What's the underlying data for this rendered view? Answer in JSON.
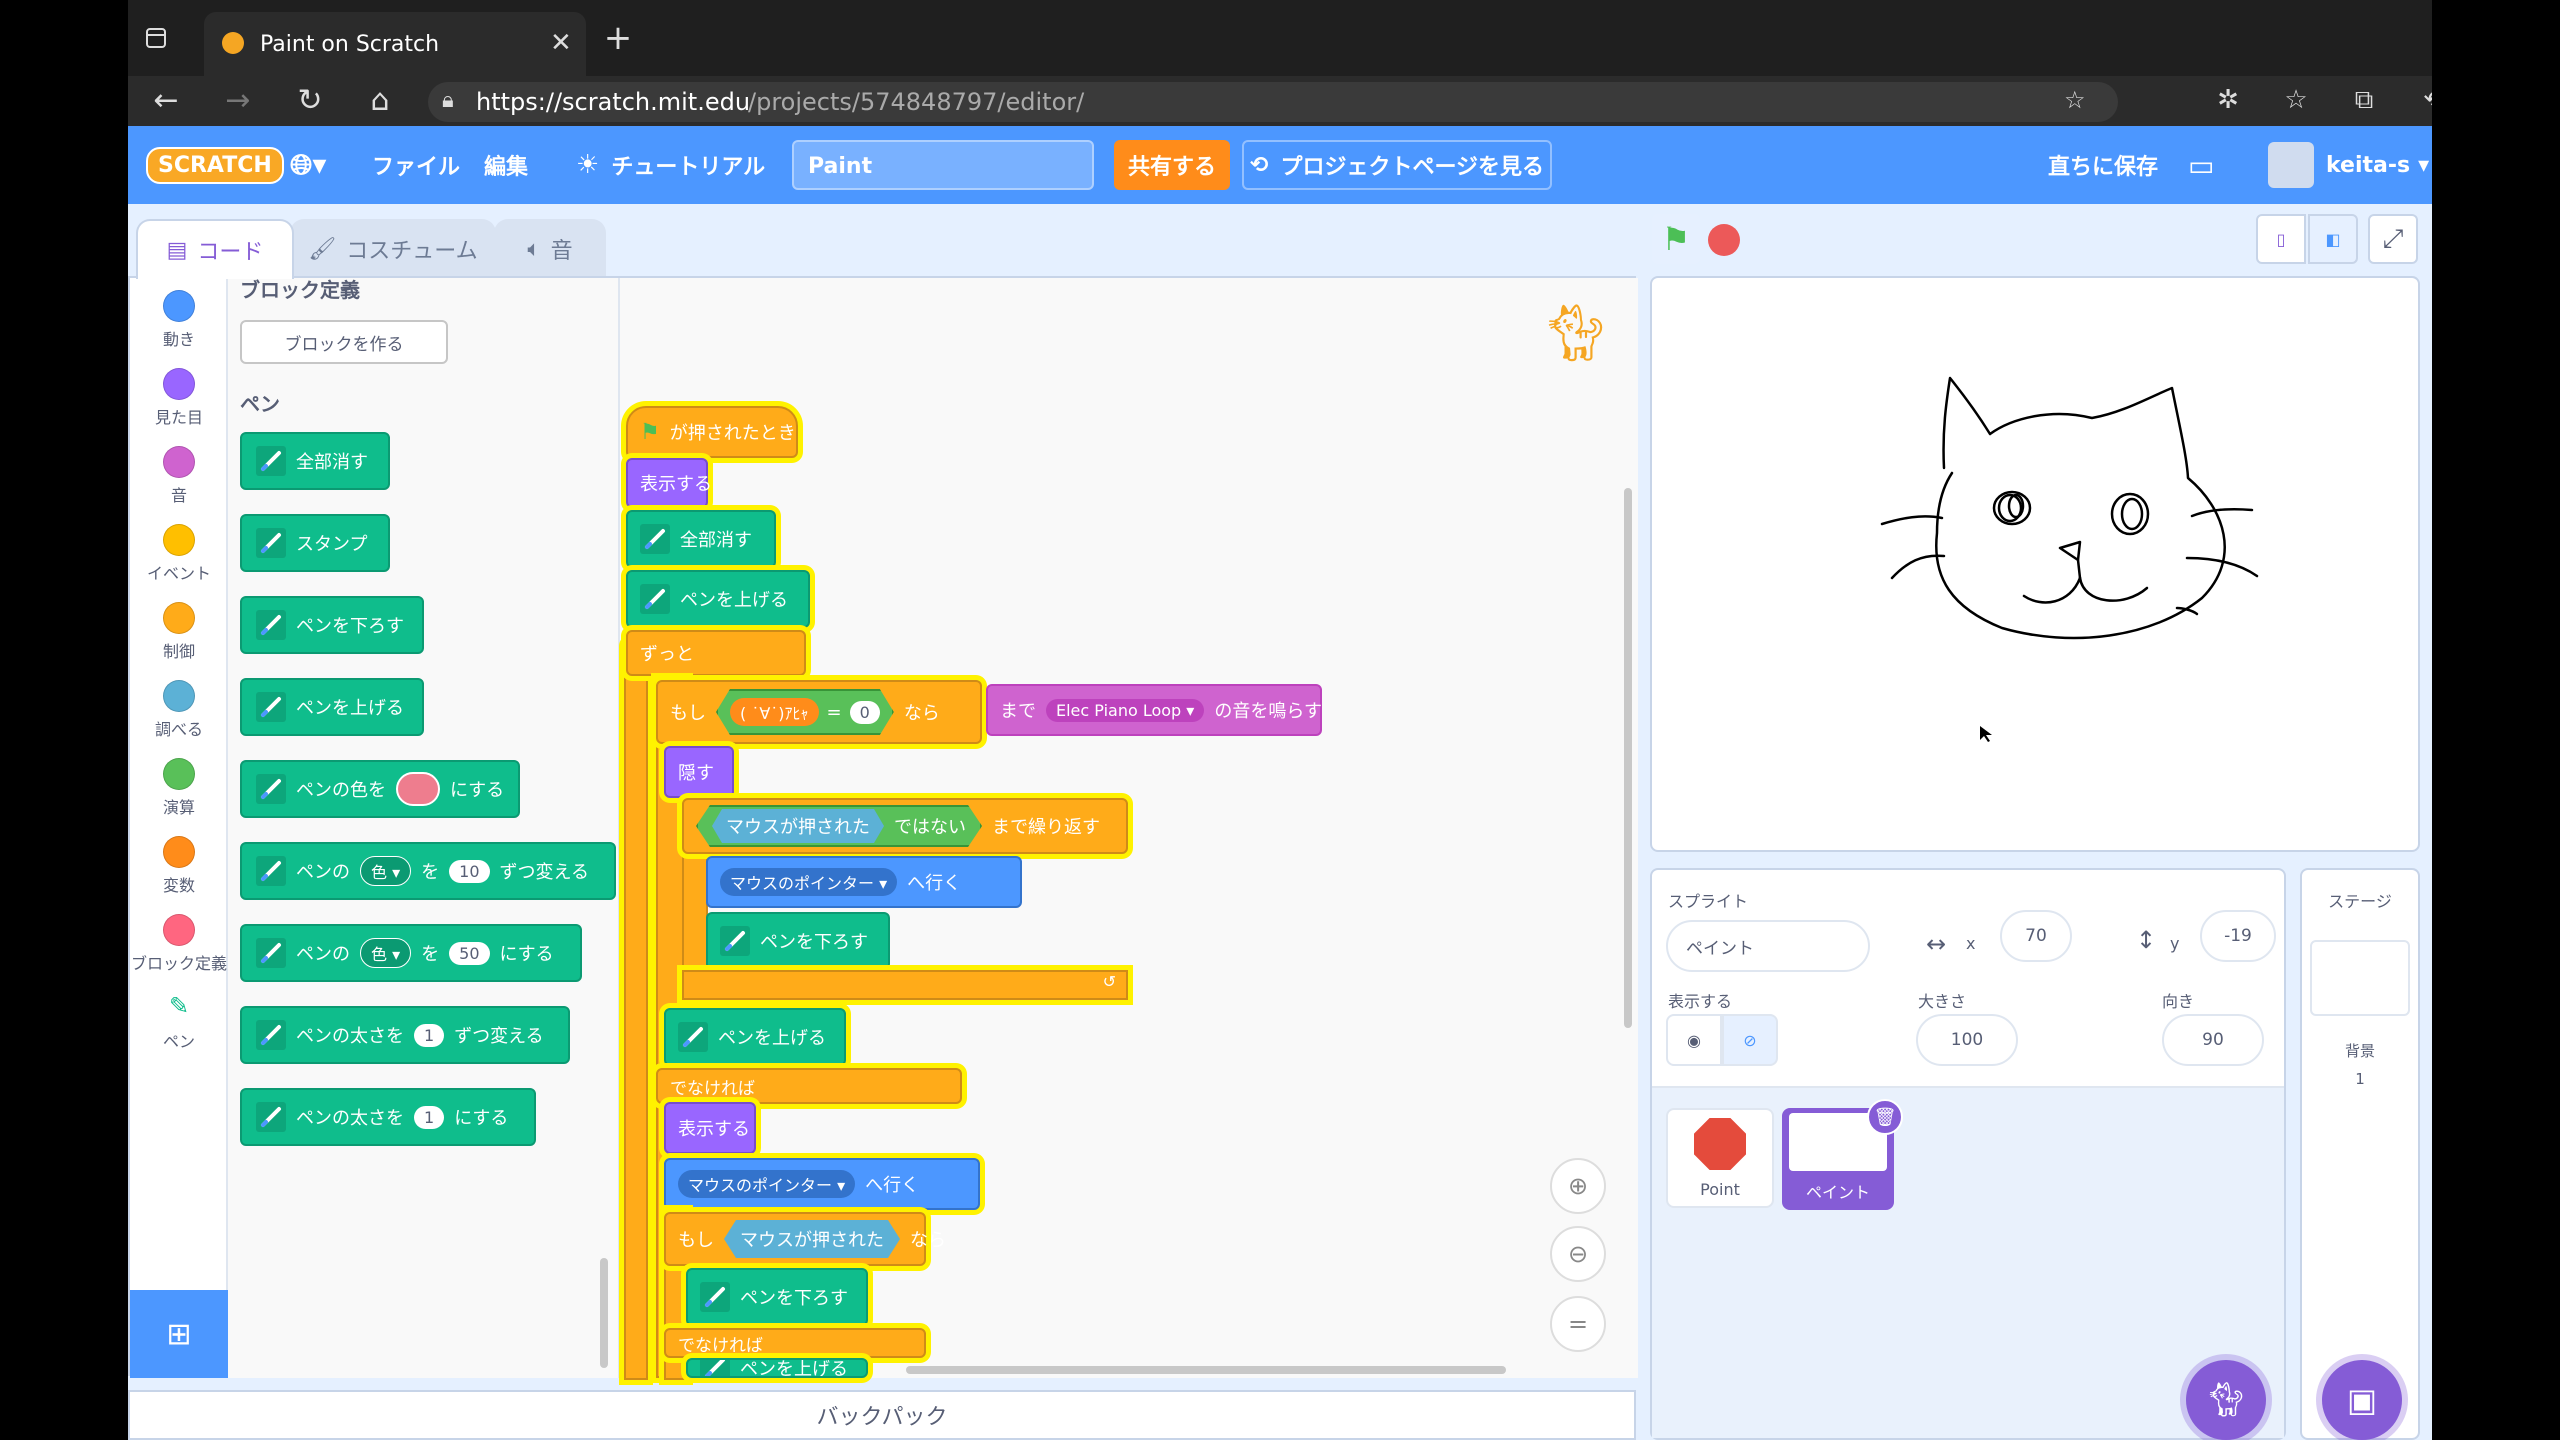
{
  "browser": {
    "tab_title": "Paint on Scratch",
    "url_host": "https://scratch.mit.edu",
    "url_path": "/projects/574848797/editor/"
  },
  "menu": {
    "logo": "SCRATCH",
    "file": "ファイル",
    "edit": "編集",
    "tutorial": "チュートリアル",
    "project_title": "Paint",
    "share": "共有する",
    "see_project_page": "プロジェクトページを見る",
    "save_now": "直ちに保存",
    "username": "keita-s"
  },
  "editor_tabs": {
    "code": "コード",
    "costumes": "コスチューム",
    "sounds": "音"
  },
  "categories": [
    {
      "label": "動き",
      "color": "#4c97ff"
    },
    {
      "label": "見た目",
      "color": "#9966ff"
    },
    {
      "label": "音",
      "color": "#cf63cf"
    },
    {
      "label": "イベント",
      "color": "#ffbf00"
    },
    {
      "label": "制御",
      "color": "#ffab19"
    },
    {
      "label": "調べる",
      "color": "#5cb1d6"
    },
    {
      "label": "演算",
      "color": "#59c059"
    },
    {
      "label": "変数",
      "color": "#ff8c1a"
    },
    {
      "label": "ブロック定義",
      "color": "#ff6680"
    },
    {
      "label": "ペン",
      "color": ""
    }
  ],
  "palette": {
    "section_my_blocks": "ブロック定義",
    "make_block": "ブロックを作る",
    "section_pen": "ペン",
    "clear": "全部消す",
    "stamp": "スタンプ",
    "pen_down": "ペンを下ろす",
    "pen_up": "ペンを上げる",
    "set_color_pre": "ペンの色を",
    "set_color_post": "にする",
    "change_param_pre": "ペンの",
    "param_color": "色",
    "change_by_mid": "を",
    "change_val": "10",
    "change_post": "ずつ変える",
    "set_param_val": "50",
    "set_param_post": "にする",
    "change_size_pre": "ペンの太さを",
    "change_size_val": "1",
    "change_size_post": "ずつ変える",
    "set_size_pre": "ペンの太さを",
    "set_size_val": "1",
    "set_size_post": "にする",
    "pen_color_swatch": "#ee7d8e"
  },
  "script": {
    "flag_clicked": "が押されたとき",
    "show": "表示する",
    "clear": "全部消す",
    "pen_up": "ペンを上げる",
    "forever": "ずっと",
    "if": "もし",
    "var": "( ˙∀˙)ｱﾋｬ",
    "equals": "=",
    "equals_val": "0",
    "then": "なら",
    "hide": "隠す",
    "mouse_down": "マウスが押された",
    "not": "ではない",
    "repeat_until": "まで繰り返す",
    "mouse_pointer": "マウスのポインター",
    "goto": "へ行く",
    "pen_down": "ペンを下ろす",
    "else": "でなければ",
    "sound_until": "まで",
    "sound_name": "Elec Piano Loop",
    "sound_play": "の音を鳴らす"
  },
  "sprite_info": {
    "sprite_label": "スプライト",
    "sprite_name": "ペイント",
    "x_label": "x",
    "x": "70",
    "y_label": "y",
    "y": "-19",
    "show_label": "表示する",
    "size_label": "大きさ",
    "size": "100",
    "direction_label": "向き",
    "direction": "90"
  },
  "sprites": [
    {
      "name": "Point"
    },
    {
      "name": "ペイント"
    }
  ],
  "stage_panel": {
    "title": "ステージ",
    "backdrop_label": "背景",
    "backdrop_count": "1"
  },
  "backpack": "バックパック"
}
